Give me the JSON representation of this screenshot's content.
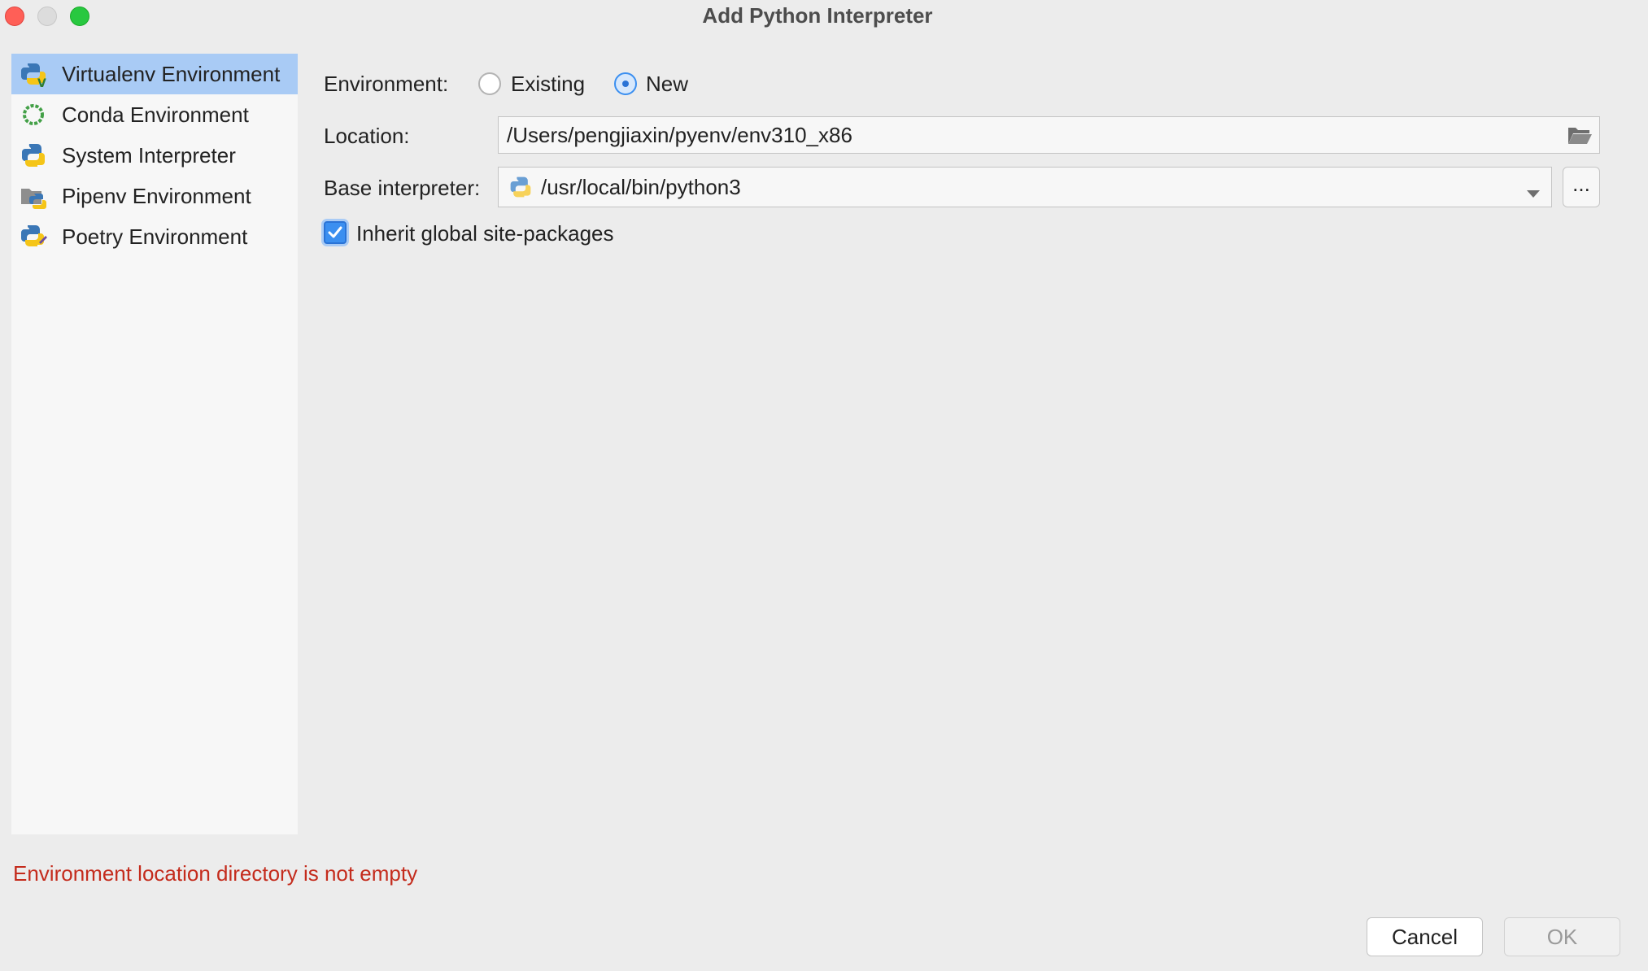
{
  "window": {
    "title": "Add Python Interpreter"
  },
  "sidebar": {
    "items": [
      {
        "label": "Virtualenv Environment",
        "icon": "python-virtualenv-icon",
        "selected": true
      },
      {
        "label": "Conda Environment",
        "icon": "conda-icon",
        "selected": false
      },
      {
        "label": "System Interpreter",
        "icon": "python-icon",
        "selected": false
      },
      {
        "label": "Pipenv Environment",
        "icon": "pipenv-icon",
        "selected": false
      },
      {
        "label": "Poetry Environment",
        "icon": "poetry-icon",
        "selected": false
      }
    ]
  },
  "form": {
    "environment_label": "Environment:",
    "existing_label": "Existing",
    "new_label": "New",
    "environment_selected": "New",
    "location_label": "Location:",
    "location_value": "/Users/pengjiaxin/pyenv/env310_x86",
    "base_label": "Base interpreter:",
    "base_value": "/usr/local/bin/python3",
    "more_label": "...",
    "inherit_label": "Inherit global site-packages",
    "inherit_checked": true
  },
  "status": {
    "error": "Environment location directory is not empty"
  },
  "buttons": {
    "cancel": "Cancel",
    "ok": "OK"
  },
  "colors": {
    "selection": "#a9cbf5",
    "accent": "#3b8ff0",
    "error": "#c42b1c"
  }
}
